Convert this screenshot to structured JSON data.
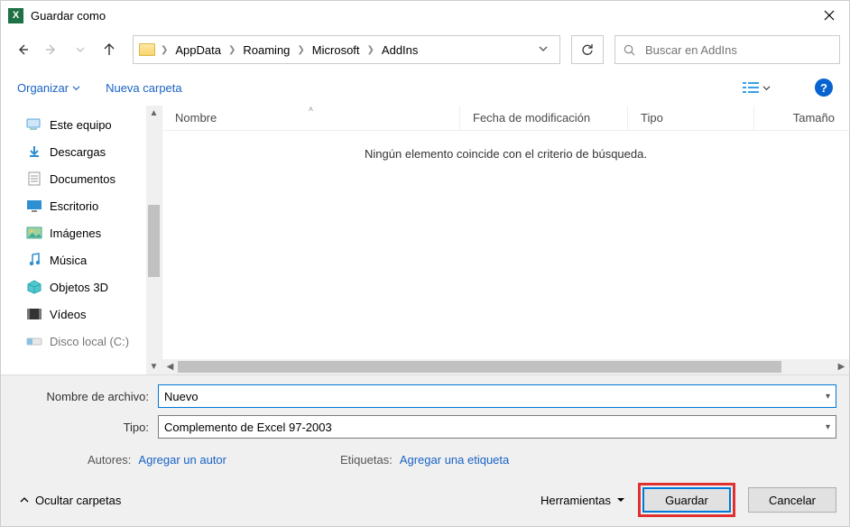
{
  "window": {
    "title": "Guardar como"
  },
  "breadcrumb": {
    "segments": [
      "AppData",
      "Roaming",
      "Microsoft",
      "AddIns"
    ]
  },
  "search": {
    "placeholder": "Buscar en AddIns"
  },
  "toolbar": {
    "organize": "Organizar",
    "new_folder": "Nueva carpeta"
  },
  "tree": {
    "items": [
      {
        "label": "Este equipo",
        "icon": "pc"
      },
      {
        "label": "Descargas",
        "icon": "download"
      },
      {
        "label": "Documentos",
        "icon": "doc"
      },
      {
        "label": "Escritorio",
        "icon": "desktop"
      },
      {
        "label": "Imágenes",
        "icon": "image"
      },
      {
        "label": "Música",
        "icon": "music"
      },
      {
        "label": "Objetos 3D",
        "icon": "cube"
      },
      {
        "label": "Vídeos",
        "icon": "video"
      },
      {
        "label": "Disco local (C:)",
        "icon": "drive"
      }
    ]
  },
  "columns": {
    "name": "Nombre",
    "date": "Fecha de modificación",
    "type": "Tipo",
    "size": "Tamaño"
  },
  "list": {
    "empty_text": "Ningún elemento coincide con el criterio de búsqueda."
  },
  "form": {
    "filename_label": "Nombre de archivo:",
    "filename_value": "Nuevo",
    "type_label": "Tipo:",
    "type_value": "Complemento de Excel 97-2003",
    "authors_label": "Autores:",
    "authors_placeholder": "Agregar un autor",
    "tags_label": "Etiquetas:",
    "tags_placeholder": "Agregar una etiqueta"
  },
  "actions": {
    "hide_folders": "Ocultar carpetas",
    "tools": "Herramientas",
    "save": "Guardar",
    "cancel": "Cancelar"
  }
}
